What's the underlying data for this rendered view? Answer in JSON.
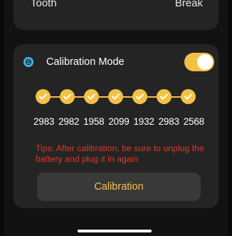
{
  "top_card": {
    "left_text": "Tooth",
    "right_text": "Break"
  },
  "calibration": {
    "mode_label": "Calibration Mode",
    "mode_icon": "calibration-icon",
    "toggle_on": true,
    "checks": [
      true,
      true,
      true,
      true,
      true,
      true,
      true
    ],
    "values": [
      "2983",
      "2982",
      "1958",
      "2099",
      "1932",
      "2983",
      "2568"
    ],
    "tips": "Tips: After calibration, be sure to unplug the battery and plug it in again",
    "button_label": "Calibration"
  },
  "colors": {
    "accent": "#f3c146",
    "warning": "#e0372b",
    "icon": "#3fb7e6",
    "card": "#242424"
  }
}
